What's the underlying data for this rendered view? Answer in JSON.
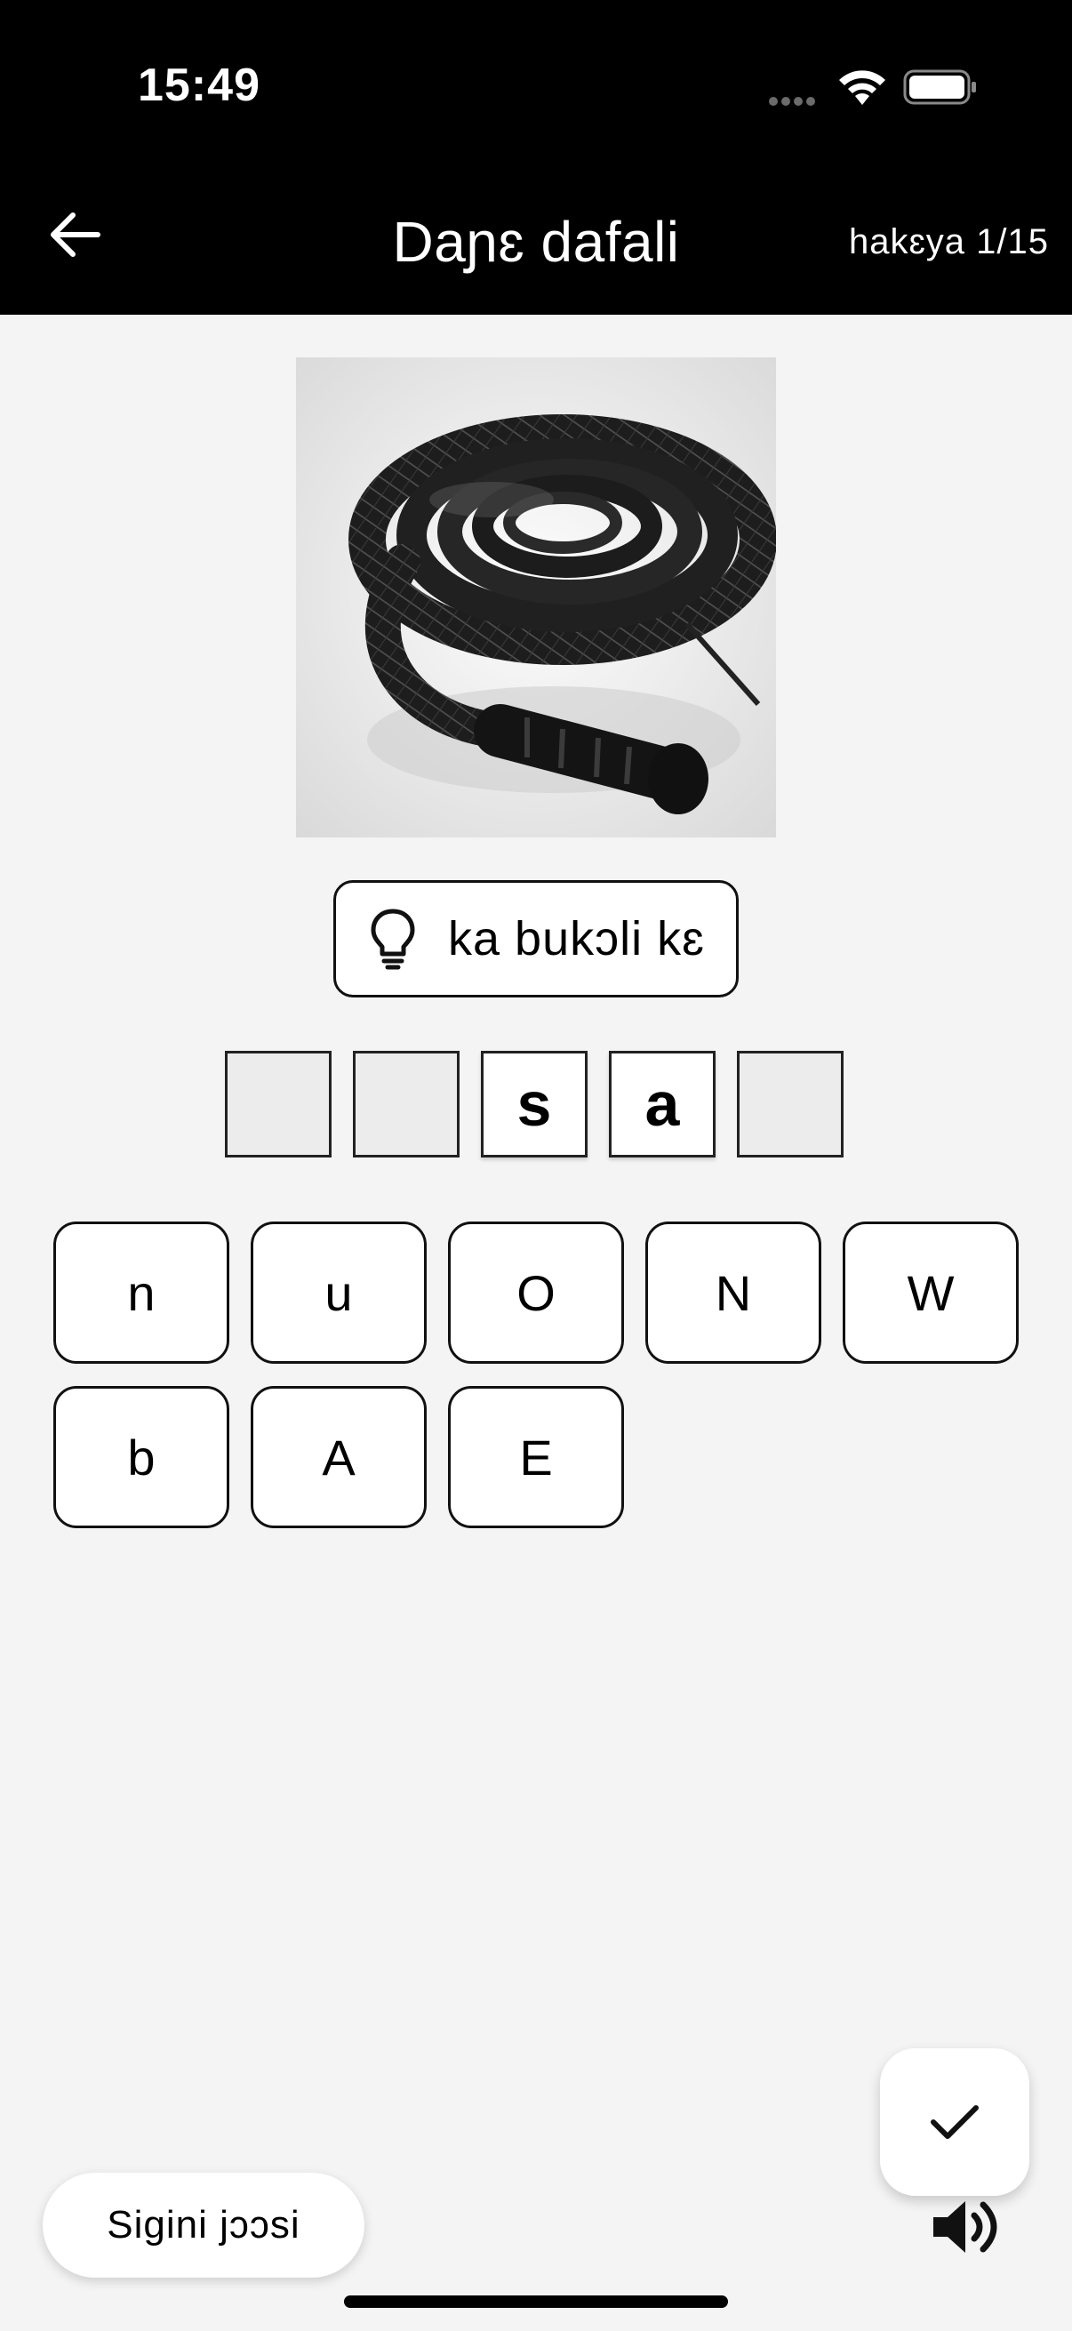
{
  "status_bar": {
    "time": "15:49"
  },
  "header": {
    "title": "Daɲɛ dafali",
    "progress": "hakɛya 1/15"
  },
  "hint": {
    "label": "ka bukɔli kɛ"
  },
  "answer_slots": [
    "",
    "",
    "s",
    "a",
    ""
  ],
  "letter_tiles": [
    "n",
    "u",
    "O",
    "N",
    "W",
    "b",
    "A",
    "E"
  ],
  "footer": {
    "pill_label": "Sigini jɔɔsi"
  },
  "icons": {
    "back": "arrow-left-icon",
    "hint": "lightbulb-icon",
    "check": "check-icon",
    "sound": "speaker-icon"
  }
}
